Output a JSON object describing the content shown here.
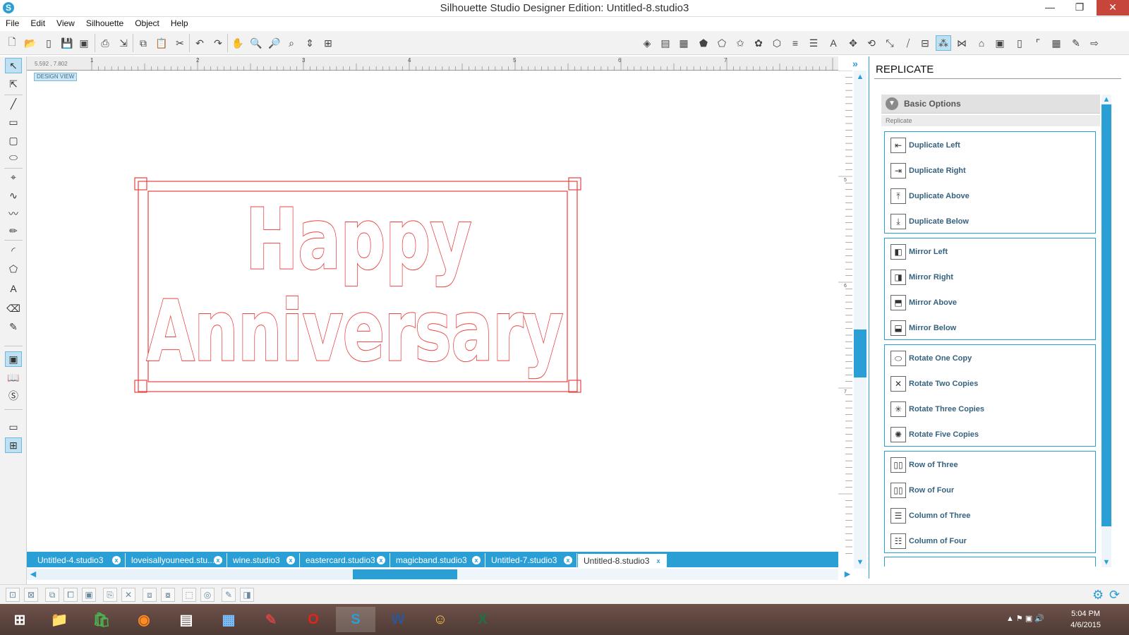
{
  "window": {
    "title": "Silhouette Studio Designer Edition: Untitled-8.studio3",
    "app_icon": "S",
    "minimize": "—",
    "restore": "❐",
    "close": "✕"
  },
  "menu": [
    "File",
    "Edit",
    "View",
    "Silhouette",
    "Object",
    "Help"
  ],
  "canvas": {
    "design_view_label": "DESIGN VIEW",
    "coordinates": "5.592 , 7.802",
    "ruler_h": [
      "1",
      "2",
      "3",
      "4",
      "5",
      "6",
      "7"
    ],
    "ruler_v": [
      "5",
      "6",
      "7"
    ],
    "artwork_text": [
      "Happy",
      "Anniversary"
    ],
    "cut_line_color": "#e8413f"
  },
  "tabs": [
    {
      "label": "Untitled-4.studio3",
      "close": "x"
    },
    {
      "label": "loveisallyouneed.stu...",
      "close": "x"
    },
    {
      "label": "wine.studio3",
      "close": "x"
    },
    {
      "label": "eastercard.studio3",
      "close": "x"
    },
    {
      "label": "magicband.studio3",
      "close": "x"
    },
    {
      "label": "Untitled-7.studio3",
      "close": "x"
    },
    {
      "label": "Untitled-8.studio3",
      "close": "x"
    }
  ],
  "panel": {
    "title": "REPLICATE",
    "section": "Basic Options",
    "sublabel": "Replicate",
    "groups": [
      {
        "options": [
          {
            "label": "Duplicate Left",
            "icon": "duplicate-left-icon"
          },
          {
            "label": "Duplicate Right",
            "icon": "duplicate-right-icon"
          },
          {
            "label": "Duplicate Above",
            "icon": "duplicate-above-icon"
          },
          {
            "label": "Duplicate Below",
            "icon": "duplicate-below-icon"
          }
        ]
      },
      {
        "options": [
          {
            "label": "Mirror Left",
            "icon": "mirror-left-icon"
          },
          {
            "label": "Mirror Right",
            "icon": "mirror-right-icon"
          },
          {
            "label": "Mirror Above",
            "icon": "mirror-above-icon"
          },
          {
            "label": "Mirror Below",
            "icon": "mirror-below-icon"
          }
        ]
      },
      {
        "options": [
          {
            "label": "Rotate One Copy",
            "icon": "rotate-one-copy-icon"
          },
          {
            "label": "Rotate Two Copies",
            "icon": "rotate-two-copies-icon"
          },
          {
            "label": "Rotate Three Copies",
            "icon": "rotate-three-copies-icon"
          },
          {
            "label": "Rotate Five Copies",
            "icon": "rotate-five-copies-icon"
          }
        ]
      },
      {
        "options": [
          {
            "label": "Row of Three",
            "icon": "row-of-three-icon"
          },
          {
            "label": "Row of Four",
            "icon": "row-of-four-icon"
          },
          {
            "label": "Column of Three",
            "icon": "column-of-three-icon"
          },
          {
            "label": "Column of Four",
            "icon": "column-of-four-icon"
          }
        ]
      }
    ]
  },
  "taskbar": {
    "time": "5:04 PM",
    "date": "4/6/2015",
    "apps": [
      "start",
      "file-explorer",
      "store",
      "firefox",
      "monitor",
      "control-panel",
      "paint",
      "opera",
      "silhouette",
      "word",
      "character-app",
      "excel"
    ]
  },
  "colors": {
    "accent": "#2a9fd6",
    "cut_line": "#e8413f",
    "close_button": "#c7463b"
  }
}
